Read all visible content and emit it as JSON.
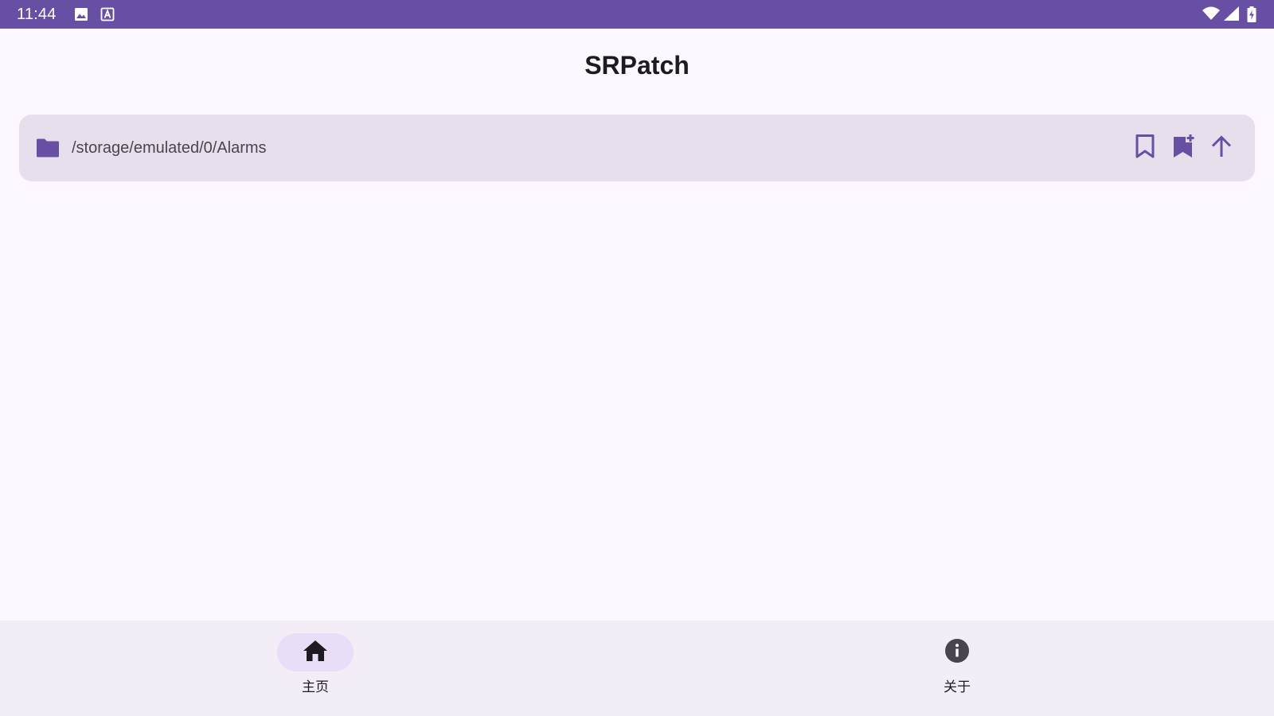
{
  "status_bar": {
    "time": "11:44",
    "left_icons": [
      "image-icon",
      "keyboard-a-icon"
    ],
    "right_icons": [
      "wifi-icon",
      "signal-icon",
      "battery-charging-icon"
    ],
    "background": "#6750a4"
  },
  "app": {
    "title": "SRPatch"
  },
  "path_bar": {
    "path": "/storage/emulated/0/Alarms",
    "icon": "folder-icon",
    "actions": [
      "bookmark-icon",
      "bookmark-add-icon",
      "arrow-up-icon"
    ]
  },
  "bottom_nav": {
    "items": [
      {
        "label": "主页",
        "icon": "home-icon",
        "selected": true
      },
      {
        "label": "关于",
        "icon": "info-icon",
        "selected": false
      }
    ]
  },
  "colors": {
    "primary": "#6750a4",
    "surface": "#fdf7ff",
    "surface_variant": "#e7e0ec",
    "nav_background": "#f3edf7",
    "nav_indicator": "#e8def8"
  }
}
